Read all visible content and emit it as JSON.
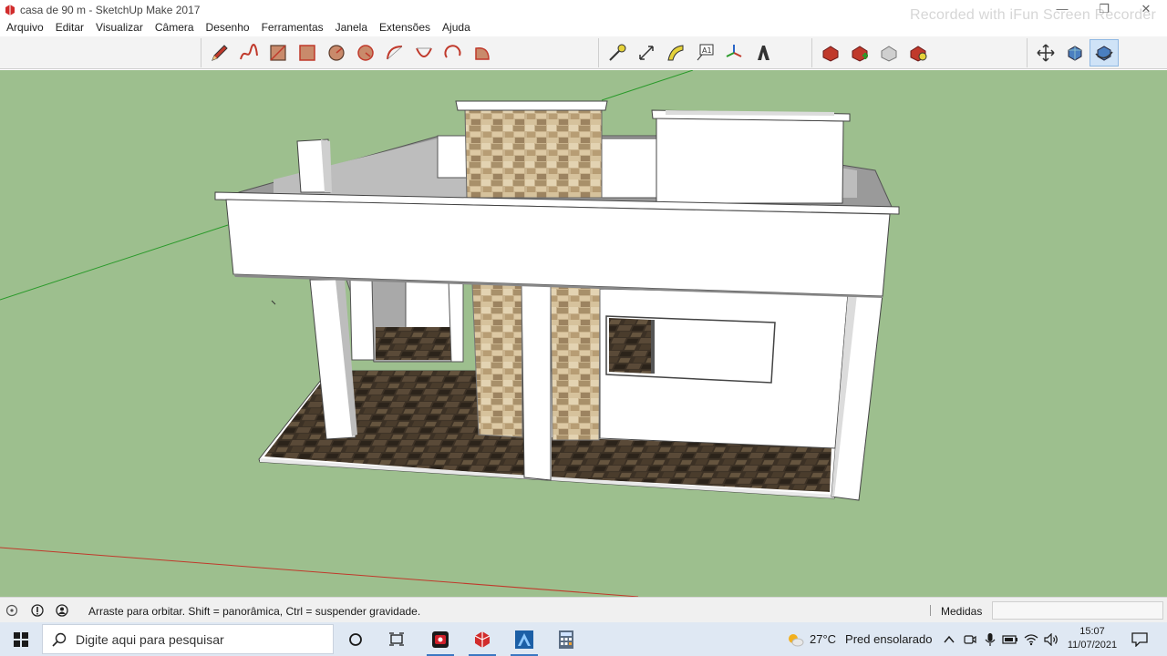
{
  "window": {
    "title": "casa de 90 m - SketchUp Make 2017",
    "watermark": "Recorded with iFun Screen Recorder",
    "minimize": "—",
    "maximize": "❐",
    "close": "✕"
  },
  "menu": [
    "Arquivo",
    "Editar",
    "Visualizar",
    "Câmera",
    "Desenho",
    "Ferramentas",
    "Janela",
    "Extensões",
    "Ajuda"
  ],
  "toolbar": {
    "drawing_tools": [
      "pencil-icon",
      "freehand-icon",
      "rectangle-icon",
      "rotated-rectangle-icon",
      "circle-icon",
      "polygon-icon",
      "arc-icon",
      "two-point-arc-icon",
      "three-point-arc-icon",
      "pie-icon"
    ],
    "construction_tools": [
      "tape-measure-icon",
      "dimensions-icon",
      "protractor-icon",
      "text-icon",
      "axes-icon",
      "3d-text-icon"
    ],
    "warehouse_tools": [
      "warehouse-icon",
      "share-model-icon",
      "share-component-icon",
      "extension-warehouse-icon"
    ],
    "camera_tools": [
      "orbit-icon",
      "pan-icon",
      "zoom-icon"
    ],
    "text_tool_label": "A1"
  },
  "statusbar": {
    "hint": "Arraste para orbitar. Shift = panorâmica, Ctrl = suspender gravidade.",
    "measure_label": "Medidas",
    "measure_value": ""
  },
  "taskbar": {
    "search_placeholder": "Digite aqui para pesquisar",
    "weather_temp": "27°C",
    "weather_condition": "Pred ensolarado",
    "time": "15:07",
    "date": "11/07/2021"
  },
  "colors": {
    "viewport_bg": "#9dbf8e",
    "toolbar_bg": "#f3f3f3",
    "taskbar_bg": "#dfe8f3",
    "active_tool": "#cfe3f7"
  }
}
